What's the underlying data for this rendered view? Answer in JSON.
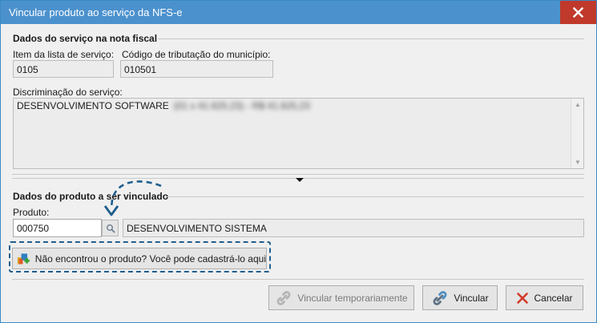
{
  "window": {
    "title": "Vincular produto ao serviço da NFS-e",
    "close_label": "✕"
  },
  "servico": {
    "section_title": "Dados do serviço na nota fiscal",
    "item_label": "Item da lista de serviço:",
    "item_value": "0105",
    "codigo_label": "Código de tributação do município:",
    "codigo_value": "010501",
    "discriminacao_label": "Discriminação do serviço:",
    "discriminacao_value": "DESENVOLVIMENTO SOFTWARE",
    "discriminacao_blurred": "(01 x 41.625,23) - R$ 41.625,23"
  },
  "produto": {
    "section_title": "Dados do produto a ser vinculado",
    "produto_label": "Produto:",
    "produto_code": "000750",
    "produto_desc": "DESENVOLVIMENTO SISTEMA",
    "cadastro_label": "Não encontrou o produto? Você pode cadastrá-lo aqui"
  },
  "buttons": {
    "temp_label": "Vincular temporariamente",
    "vincular_label": "Vincular",
    "cancelar_label": "Cancelar"
  },
  "colors": {
    "titlebar": "#4b91cd",
    "close": "#c0392b",
    "annotation": "#1f5f8f"
  },
  "icons": {
    "lookup": "search-icon",
    "cadastro": "add-product-icon",
    "link": "link-icon",
    "cancel": "cancel-x-icon"
  }
}
